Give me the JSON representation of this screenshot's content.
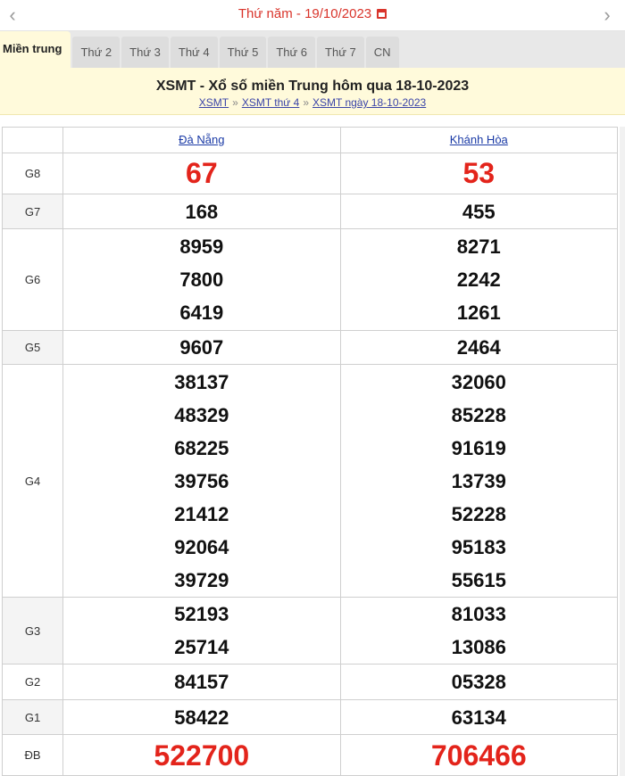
{
  "date_bar": {
    "prev_arrow": "‹",
    "next_arrow": "›",
    "label": "Thứ năm -  19/10/2023",
    "icon": "calendar-icon"
  },
  "tabs": [
    {
      "label": "Miền trung",
      "active": true
    },
    {
      "label": "Thứ 2"
    },
    {
      "label": "Thứ 3"
    },
    {
      "label": "Thứ 4"
    },
    {
      "label": "Thứ 5"
    },
    {
      "label": "Thứ 6"
    },
    {
      "label": "Thứ 7"
    },
    {
      "label": "CN"
    }
  ],
  "header": {
    "title": "XSMT - Xổ số miền Trung hôm qua 18-10-2023",
    "breadcrumb": [
      "XSMT",
      "XSMT thứ 4",
      "XSMT ngày 18-10-2023"
    ],
    "separator": "»"
  },
  "provinces": [
    "Đà Nẵng",
    "Khánh Hòa"
  ],
  "prizes": [
    {
      "label": "G8",
      "da_nang": [
        "67"
      ],
      "khanh_hoa": [
        "53"
      ]
    },
    {
      "label": "G7",
      "da_nang": [
        "168"
      ],
      "khanh_hoa": [
        "455"
      ]
    },
    {
      "label": "G6",
      "da_nang": [
        "8959",
        "7800",
        "6419"
      ],
      "khanh_hoa": [
        "8271",
        "2242",
        "1261"
      ]
    },
    {
      "label": "G5",
      "da_nang": [
        "9607"
      ],
      "khanh_hoa": [
        "2464"
      ]
    },
    {
      "label": "G4",
      "da_nang": [
        "38137",
        "48329",
        "68225",
        "39756",
        "21412",
        "92064",
        "39729"
      ],
      "khanh_hoa": [
        "32060",
        "85228",
        "91619",
        "13739",
        "52228",
        "95183",
        "55615"
      ]
    },
    {
      "label": "G3",
      "da_nang": [
        "52193",
        "25714"
      ],
      "khanh_hoa": [
        "81033",
        "13086"
      ]
    },
    {
      "label": "G2",
      "da_nang": [
        "84157"
      ],
      "khanh_hoa": [
        "05328"
      ]
    },
    {
      "label": "G1",
      "da_nang": [
        "58422"
      ],
      "khanh_hoa": [
        "63134"
      ]
    },
    {
      "label": "ĐB",
      "da_nang": [
        "522700"
      ],
      "khanh_hoa": [
        "706466"
      ]
    }
  ],
  "colors": {
    "accent_red": "#e3241b",
    "header_bg": "#fffadb",
    "link_blue": "#1a3aa6"
  }
}
